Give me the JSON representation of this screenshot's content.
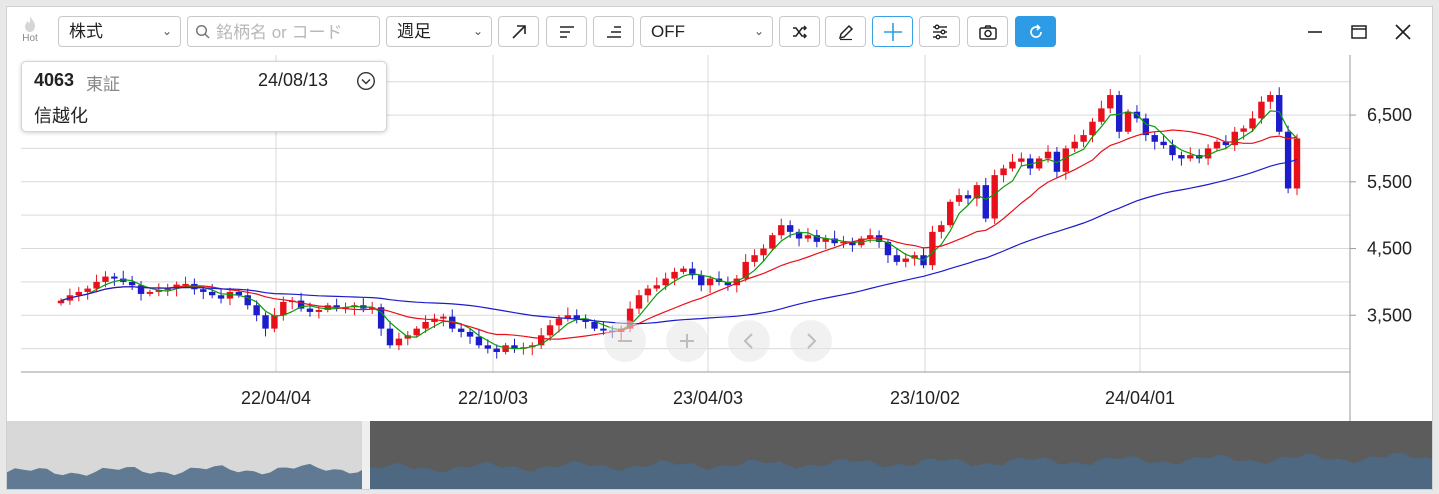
{
  "toolbar": {
    "hot_label": "Hot",
    "market_select": "株式",
    "search_placeholder": "銘柄名 or コード",
    "period_select": "週足",
    "indicator_select": "OFF"
  },
  "info": {
    "code": "4063",
    "exchange": "東証",
    "date": "24/08/13",
    "name": "信越化"
  },
  "chart_data": {
    "type": "candlestick",
    "x_ticks": [
      "22/04/04",
      "22/10/03",
      "23/04/03",
      "23/10/02",
      "24/04/01"
    ],
    "y_ticks": [
      "6,500",
      "5,500",
      "4,500",
      "3,500"
    ],
    "y_tick_values": [
      6500,
      5500,
      4500,
      3500
    ],
    "ylim": [
      2650,
      7400
    ],
    "grid": true,
    "series": [
      {
        "kind": "candles",
        "up_color": "#e8101a",
        "down_color": "#1c1ccc"
      },
      {
        "kind": "ma_short",
        "color": "#0a9a0a"
      },
      {
        "kind": "ma_mid",
        "color": "#e8101a"
      },
      {
        "kind": "ma_long",
        "color": "#1c1ccc"
      }
    ],
    "closes": [
      3720,
      3800,
      3850,
      3900,
      4000,
      4080,
      4050,
      4000,
      3950,
      3820,
      3850,
      3880,
      3900,
      3960,
      3970,
      3890,
      3850,
      3800,
      3750,
      3850,
      3800,
      3650,
      3500,
      3300,
      3500,
      3700,
      3720,
      3600,
      3550,
      3580,
      3650,
      3620,
      3620,
      3650,
      3600,
      3620,
      3300,
      3050,
      3150,
      3200,
      3300,
      3400,
      3450,
      3480,
      3300,
      3250,
      3180,
      3050,
      3000,
      2950,
      3050,
      3000,
      3020,
      3050,
      3200,
      3350,
      3450,
      3500,
      3450,
      3400,
      3300,
      3270,
      3250,
      3300,
      3600,
      3800,
      3900,
      3950,
      4050,
      4150,
      4200,
      4100,
      3950,
      4050,
      4000,
      3950,
      4050,
      4300,
      4400,
      4500,
      4700,
      4850,
      4750,
      4650,
      4700,
      4600,
      4650,
      4580,
      4600,
      4550,
      4650,
      4700,
      4600,
      4400,
      4300,
      4350,
      4400,
      4250,
      4750,
      4850,
      5200,
      5300,
      5250,
      5450,
      4950,
      5600,
      5700,
      5800,
      5850,
      5700,
      5850,
      5950,
      5650,
      6000,
      6100,
      6200,
      6400,
      6600,
      6800,
      6250,
      6550,
      6450,
      6200,
      6100,
      6050,
      5900,
      5850,
      5900,
      5850,
      6000,
      6100,
      6050,
      6250,
      6300,
      6450,
      6700,
      6800,
      6250,
      5400,
      6150
    ],
    "highs_offset": 90,
    "lows_offset": 90
  },
  "navigator": {
    "fill_color": "#4a6a86"
  },
  "colors": {
    "accent": "#2e9be6",
    "up": "#e8101a",
    "down": "#1c1ccc",
    "ma_short": "#0a9a0a",
    "grid": "#d9d9d9"
  },
  "overlay_controls": [
    "zoom-out",
    "zoom-in",
    "scroll-left",
    "scroll-right"
  ]
}
